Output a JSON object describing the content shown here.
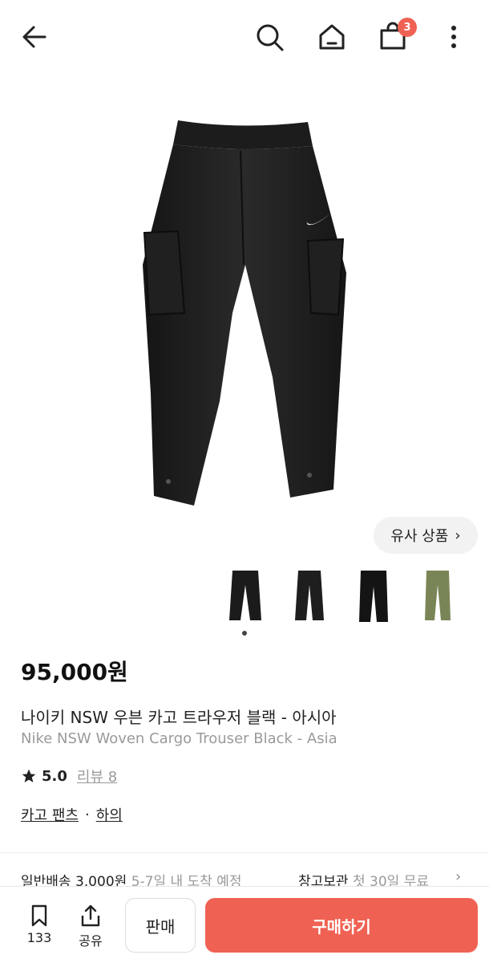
{
  "topbar": {
    "cart_badge": "3",
    "icons": [
      "back-arrow-icon",
      "search-icon",
      "home-icon",
      "shopping-bag-icon",
      "more-vertical-icon"
    ]
  },
  "product": {
    "similar_button": "유사 상품",
    "thumbnails": [
      {
        "name": "black-front",
        "color": "#1b1b1b"
      },
      {
        "name": "black-side",
        "color": "#1e1e1e"
      },
      {
        "name": "black-back",
        "color": "#141414"
      },
      {
        "name": "olive",
        "color": "#7a8557"
      }
    ],
    "price": "95,000원",
    "title_ko": "나이키 NSW 우븐 카고 트라우저 블랙 - 아시아",
    "title_en": "Nike NSW Woven Cargo Trouser Black - Asia",
    "rating": "5.0",
    "review_link": "리뷰 8",
    "category_1": "카고 팬츠",
    "category_sep": "·",
    "category_2": "하의"
  },
  "shipping": {
    "label": "일반배송 3,000원",
    "eta": "5-7일 내 도착 예정",
    "storage_label": "창고보관",
    "storage_note": "첫 30일 무료"
  },
  "bottom": {
    "bookmark_count": "133",
    "share_label": "공유",
    "sell_label": "판매",
    "buy_label": "구매하기"
  },
  "colors": {
    "accent": "#ef6253",
    "muted_text": "#9a9a9a"
  }
}
